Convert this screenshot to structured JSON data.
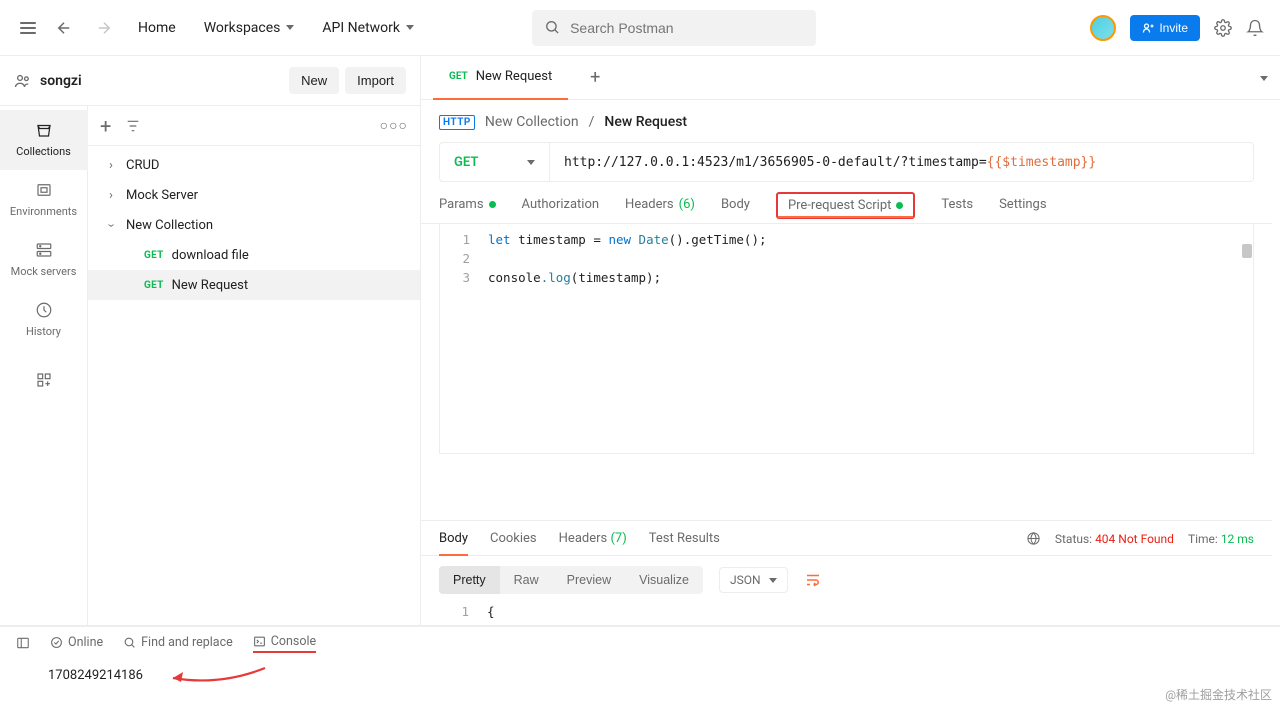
{
  "header": {
    "home": "Home",
    "workspaces": "Workspaces",
    "api_network": "API Network",
    "search_placeholder": "Search Postman",
    "invite": "Invite"
  },
  "workspace": {
    "name": "songzi",
    "new_btn": "New",
    "import_btn": "Import"
  },
  "rail": {
    "collections": "Collections",
    "environments": "Environments",
    "mock_servers": "Mock servers",
    "history": "History"
  },
  "tree": {
    "items": [
      "CRUD",
      "Mock Server",
      "New Collection"
    ],
    "requests": [
      {
        "method": "GET",
        "name": "download file"
      },
      {
        "method": "GET",
        "name": "New Request"
      }
    ]
  },
  "tab": {
    "method": "GET",
    "title": "New Request"
  },
  "crumb": {
    "collection": "New Collection",
    "request": "New Request",
    "badge": "HTTP"
  },
  "url": {
    "method": "GET",
    "base": "http://127.0.0.1:4523/m1/3656905-0-default/?timestamp=",
    "var": "{{$timestamp}}"
  },
  "sections": {
    "params": "Params",
    "authorization": "Authorization",
    "headers": "Headers",
    "headers_count": "(6)",
    "body": "Body",
    "pre_request": "Pre-request Script",
    "tests": "Tests",
    "settings": "Settings"
  },
  "code": {
    "lines": [
      "1",
      "2",
      "3"
    ],
    "l1_kw1": "let",
    "l1_var": " timestamp ",
    "l1_eq": "= ",
    "l1_kw2": "new",
    "l1_cls": " Date",
    "l1_rest": "().getTime();",
    "l3_obj": "console",
    "l3_fn": ".log",
    "l3_rest": "(timestamp);"
  },
  "response": {
    "tabs": {
      "body": "Body",
      "cookies": "Cookies",
      "headers": "Headers",
      "headers_count": "(7)",
      "test_results": "Test Results"
    },
    "status_label": "Status:",
    "status_value": "404 Not Found",
    "time_label": "Time:",
    "time_value": "12 ms",
    "view": {
      "pretty": "Pretty",
      "raw": "Raw",
      "preview": "Preview",
      "visualize": "Visualize",
      "format": "JSON"
    },
    "body_line": "1",
    "body_text": "{"
  },
  "footer": {
    "online": "Online",
    "find": "Find and replace",
    "console": "Console"
  },
  "console_value": "1708249214186",
  "watermark": "@稀土掘金技术社区"
}
